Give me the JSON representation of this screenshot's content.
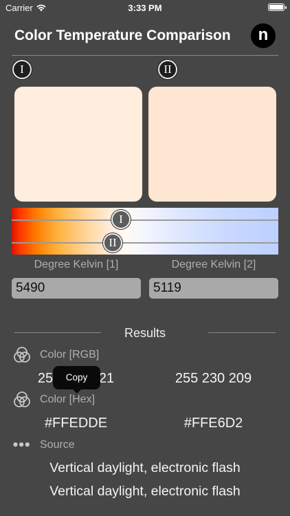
{
  "status_bar": {
    "carrier": "Carrier",
    "time": "3:33 PM"
  },
  "header": {
    "title": "Color Temperature Comparison",
    "logo_letter": "n"
  },
  "markers": {
    "first": "I",
    "second": "II"
  },
  "swatches": {
    "first_color": "#FFEDDE",
    "second_color": "#FFE6D2"
  },
  "kelvin": {
    "label_1": "Degree Kelvin [1]",
    "label_2": "Degree Kelvin [2]",
    "value_1": "5490",
    "value_2": "5119"
  },
  "results": {
    "heading": "Results",
    "rgb_label": "Color [RGB]",
    "rgb_1": "255 237 221",
    "rgb_2": "255 230 209",
    "hex_label": "Color [Hex]",
    "hex_1": "#FFEDDE",
    "hex_2": "#FFE6D2",
    "source_label": "Source",
    "source_1": "Vertical daylight, electronic flash",
    "source_2": "Vertical daylight, electronic flash"
  },
  "tooltip": {
    "copy": "Copy"
  },
  "icons": {
    "rgb": "color-circles-icon",
    "hex": "color-circles-icon",
    "source": "more-dots-icon"
  }
}
